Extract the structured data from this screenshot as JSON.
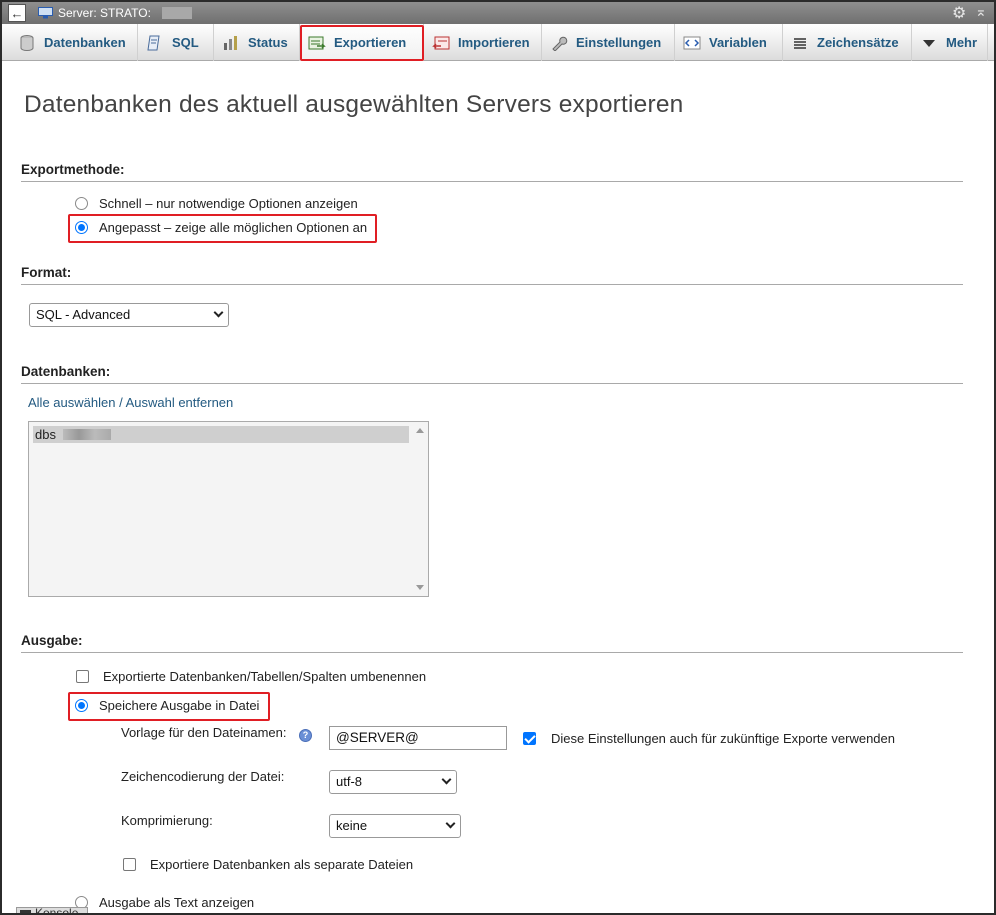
{
  "titlebar": {
    "back": "←",
    "title": "Server: STRATO:"
  },
  "tabs": [
    {
      "label": "Datenbanken"
    },
    {
      "label": "SQL"
    },
    {
      "label": "Status"
    },
    {
      "label": "Exportieren"
    },
    {
      "label": "Importieren"
    },
    {
      "label": "Einstellungen"
    },
    {
      "label": "Variablen"
    },
    {
      "label": "Zeichensätze"
    },
    {
      "label": "Mehr"
    }
  ],
  "heading": "Datenbanken des aktuell ausgewählten Servers exportieren",
  "exportmethod": {
    "title": "Exportmethode:",
    "quick": "Schnell – nur notwendige Optionen anzeigen",
    "custom": "Angepasst – zeige alle möglichen Optionen an"
  },
  "format": {
    "title": "Format:",
    "selected": "SQL - Advanced"
  },
  "databases": {
    "title": "Datenbanken:",
    "select_all": "Alle auswählen",
    "separator": " / ",
    "deselect": "Auswahl entfernen",
    "items": [
      "dbs"
    ]
  },
  "output": {
    "title": "Ausgabe:",
    "rename": "Exportierte Datenbanken/Tabellen/Spalten umbenennen",
    "save_file": "Speichere Ausgabe in Datei",
    "template_label": "Vorlage für den Dateinamen:",
    "template_value": "@SERVER@",
    "remember": "Diese Einstellungen auch für zukünftige Exporte verwenden",
    "charset_label": "Zeichencodierung der Datei:",
    "charset_value": "utf-8",
    "compression_label": "Komprimierung:",
    "compression_value": "keine",
    "separate_files": "Exportiere Datenbanken als separate Dateien",
    "as_text": "Ausgabe als Text anzeigen"
  },
  "console": "Konsole"
}
